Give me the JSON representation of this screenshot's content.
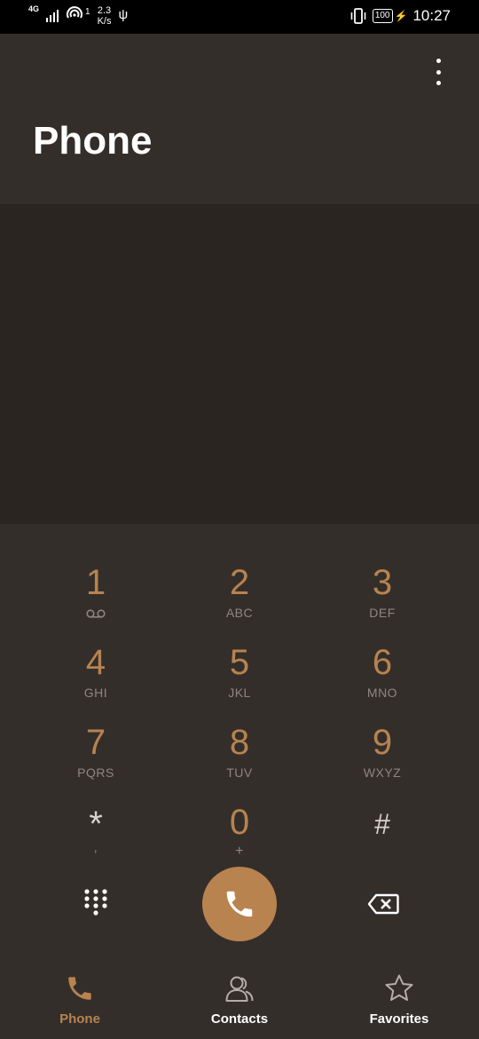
{
  "status_bar": {
    "network": "4G",
    "wifi_count": "1",
    "speed_value": "2.3",
    "speed_unit": "K/s",
    "battery": "100",
    "time": "10:27",
    "icons": [
      "signal-icon",
      "wifi-hotspot-icon",
      "usb-icon",
      "vibrate-icon",
      "battery-icon",
      "charging-bolt-icon"
    ]
  },
  "header": {
    "title": "Phone",
    "menu_icon": "more-vertical-icon"
  },
  "dialpad": {
    "keys": [
      {
        "digit": "1",
        "letters": "",
        "icon": "voicemail-icon"
      },
      {
        "digit": "2",
        "letters": "ABC"
      },
      {
        "digit": "3",
        "letters": "DEF"
      },
      {
        "digit": "4",
        "letters": "GHI"
      },
      {
        "digit": "5",
        "letters": "JKL"
      },
      {
        "digit": "6",
        "letters": "MNO"
      },
      {
        "digit": "7",
        "letters": "PQRS"
      },
      {
        "digit": "8",
        "letters": "TUV"
      },
      {
        "digit": "9",
        "letters": "WXYZ"
      },
      {
        "digit": "*",
        "letters": ","
      },
      {
        "digit": "0",
        "letters": "+"
      },
      {
        "digit": "#",
        "letters": ""
      }
    ],
    "actions": {
      "left_icon": "dialpad-toggle-icon",
      "call_icon": "phone-call-icon",
      "right_icon": "backspace-icon"
    }
  },
  "bottom_nav": {
    "items": [
      {
        "label": "Phone",
        "icon": "phone-icon",
        "active": true
      },
      {
        "label": "Contacts",
        "icon": "contacts-icon",
        "active": false
      },
      {
        "label": "Favorites",
        "icon": "star-icon",
        "active": false
      }
    ]
  },
  "colors": {
    "accent": "#b8834f",
    "background": "#2b2522",
    "surface": "#342e2b",
    "status_bar": "#000000"
  }
}
